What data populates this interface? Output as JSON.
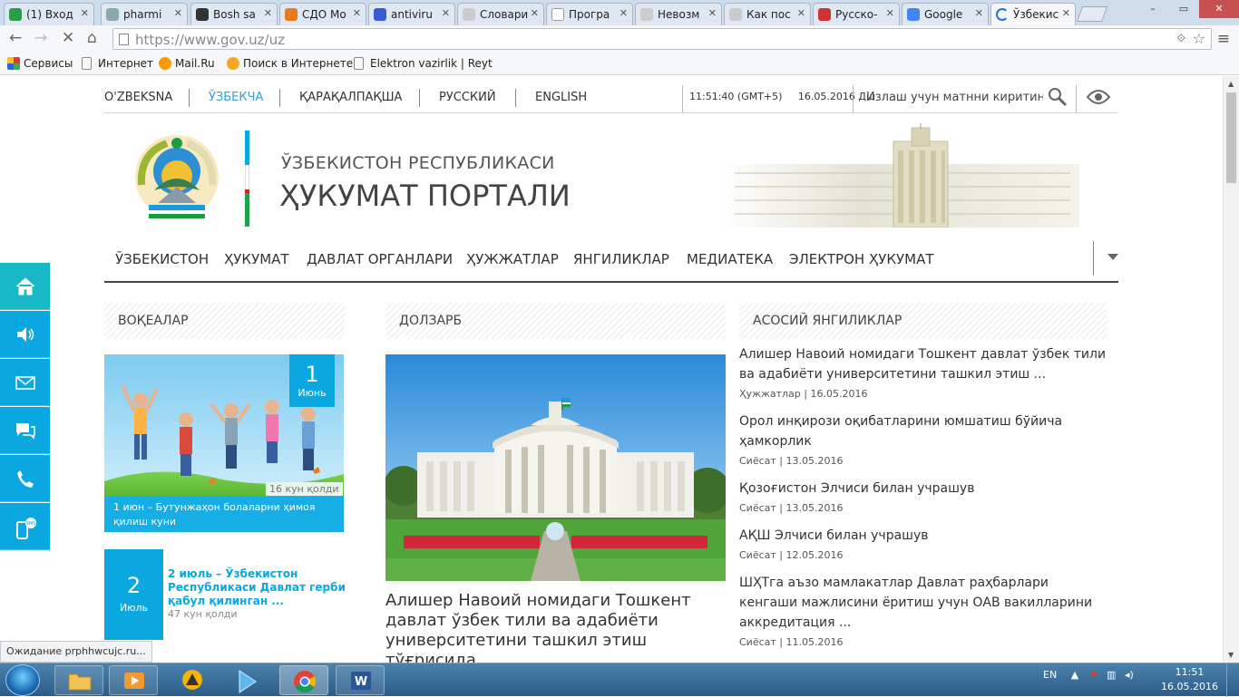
{
  "browser": {
    "tabs": [
      {
        "title": "(1) Вход",
        "color": "#2a9d4a"
      },
      {
        "title": "pharmi",
        "color": "#8aa"
      },
      {
        "title": "Bosh sa",
        "color": "#333"
      },
      {
        "title": "СДО Мо",
        "color": "#e67b1e"
      },
      {
        "title": "antiviru",
        "color": "#3b5bdb"
      },
      {
        "title": "Словари",
        "color": "#ccc"
      },
      {
        "title": "Програ",
        "color": "#fff"
      },
      {
        "title": "Невозм",
        "color": "#ccc"
      },
      {
        "title": "Как пос",
        "color": "#ccc"
      },
      {
        "title": "Русско-",
        "color": "#c33"
      },
      {
        "title": "Google",
        "color": "#4285f4"
      },
      {
        "title": "Ўзбекис",
        "color": "#1a73e8"
      }
    ],
    "url_host": "https://www.gov.uz",
    "url_path": "/uz",
    "bookmarks": [
      "Сервисы",
      "Интернет",
      "Mail.Ru",
      "Поиск в Интернете",
      "Elektron vazirlik | Reyt"
    ],
    "status_text": "Ожидание prphhwcujc.ru..."
  },
  "header": {
    "languages": [
      "O'ZBEKSNA",
      "ЎЗБЕКЧА",
      "ҚАРАҚАЛПАҚША",
      "РУССКИЙ",
      "ENGLISH"
    ],
    "active_language_index": 1,
    "time": "11:51:40 (GMT+5)",
    "date": "16.05.2016 Дш",
    "search_placeholder": "Излаш учун матнни киритинг...",
    "title_top": "ЎЗБЕКИСТОН РЕСПУБЛИКАСИ",
    "title_main": "ҲУКУМАТ ПОРТАЛИ"
  },
  "nav": [
    "ЎЗБЕКИСТОН",
    "ҲУКУМАТ",
    "ДАВЛАТ ОРГАНЛАРИ",
    "ҲУЖЖАТЛАР",
    "ЯНГИЛИКЛАР",
    "МЕДИАТЕКА",
    "ЭЛЕКТРОН ҲУКУМАТ"
  ],
  "columns": {
    "events": {
      "heading": "ВОҚЕАЛАР",
      "event1": {
        "day": "1",
        "month": "Июнь",
        "left": "16 кун қолди",
        "caption": "1 июн – Бутунжаҳон болаларни ҳимоя қилиш куни"
      },
      "event2": {
        "day": "2",
        "month": "Июль",
        "title": "2 июль – Ўзбекистон Республикаси Давлат герби қабул қилинган ...",
        "left": "47 кун қолди"
      }
    },
    "topical": {
      "heading": "ДОЛЗАРБ",
      "title": "Алишер Навоий номидаги Тошкент давлат ўзбек тили ва адабиёти университетини ташкил этиш тўғрисида"
    },
    "news": {
      "heading": "АСОСИЙ ЯНГИЛИКЛАР",
      "items": [
        {
          "title": "Алишер Навоий номидаги Тошкент давлат ўзбек тили ва адабиёти университетини ташкил этиш ...",
          "category": "Ҳужжатлар",
          "date": "16.05.2016"
        },
        {
          "title": "Орол инқирози оқибатларини юмшатиш бўйича ҳамкорлик",
          "category": "Сиёсат",
          "date": "13.05.2016"
        },
        {
          "title": "Қозоғистон Элчиси билан учрашув",
          "category": "Сиёсат",
          "date": "13.05.2016"
        },
        {
          "title": "АҚШ Элчиси билан учрашув",
          "category": "Сиёсат",
          "date": "12.05.2016"
        },
        {
          "title": "ШҲТга аъзо мамлакатлар Давлат раҳбарлари кенгаши мажлисини ёритиш учун ОАВ вакилларини аккредитация ...",
          "category": "Сиёсат",
          "date": "11.05.2016"
        }
      ]
    }
  },
  "taskbar": {
    "lang": "EN",
    "time": "11:51",
    "date": "16.05.2016"
  },
  "colors": {
    "accent": "#0aa7e0",
    "nav_line": "#444444"
  }
}
